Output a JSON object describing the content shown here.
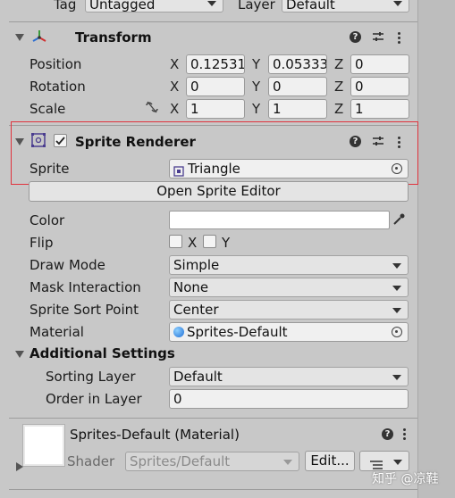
{
  "top_row": {
    "tag_label": "Tag",
    "tag_value": "Untagged",
    "layer_label": "Layer",
    "layer_value": "Default"
  },
  "transform": {
    "title": "Transform",
    "rows": [
      {
        "label": "Position",
        "x": "0.125310",
        "y": "0.053333",
        "z": "0"
      },
      {
        "label": "Rotation",
        "x": "0",
        "y": "0",
        "z": "0"
      },
      {
        "label": "Scale",
        "x": "1",
        "y": "1",
        "z": "1"
      }
    ],
    "axis_x": "X",
    "axis_y": "Y",
    "axis_z": "Z"
  },
  "sprite_renderer": {
    "title": "Sprite Renderer",
    "enabled": true,
    "sprite_label": "Sprite",
    "sprite_value": "Triangle",
    "open_editor_label": "Open Sprite Editor",
    "color_label": "Color",
    "color_value": "#ffffff",
    "flip_label": "Flip",
    "flip_x": "X",
    "flip_y": "Y",
    "draw_mode_label": "Draw Mode",
    "draw_mode_value": "Simple",
    "mask_label": "Mask Interaction",
    "mask_value": "None",
    "sort_point_label": "Sprite Sort Point",
    "sort_point_value": "Center",
    "material_label": "Material",
    "material_value": "Sprites-Default",
    "additional_title": "Additional Settings",
    "sorting_layer_label": "Sorting Layer",
    "sorting_layer_value": "Default",
    "order_label": "Order in Layer",
    "order_value": "0"
  },
  "material_section": {
    "title": "Sprites-Default (Material)",
    "shader_label": "Shader",
    "shader_value": "Sprites/Default",
    "edit_label": "Edit..."
  },
  "watermark": "知乎 @凉鞋",
  "colors": {
    "highlight": "#e0323c",
    "panel": "#c8c8c8",
    "field": "#f0f0f0"
  }
}
